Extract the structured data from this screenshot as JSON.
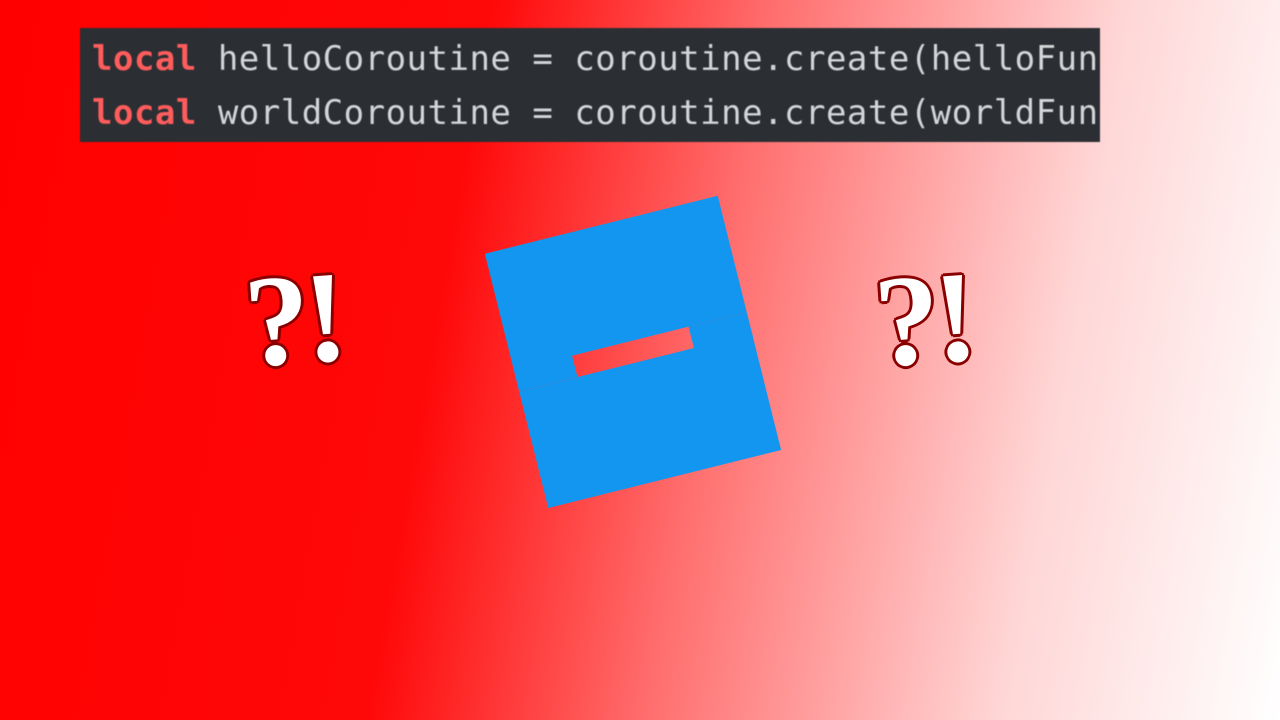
{
  "code": {
    "keyword": "local",
    "line1_rest": " helloCoroutine = coroutine.create(helloFunction)",
    "line2_rest": " worldCoroutine = coroutine.create(worldFunction)"
  },
  "marks": {
    "text": "?!"
  },
  "logo": {
    "name": "roblox-studio-logo",
    "color": "#1296ef"
  }
}
